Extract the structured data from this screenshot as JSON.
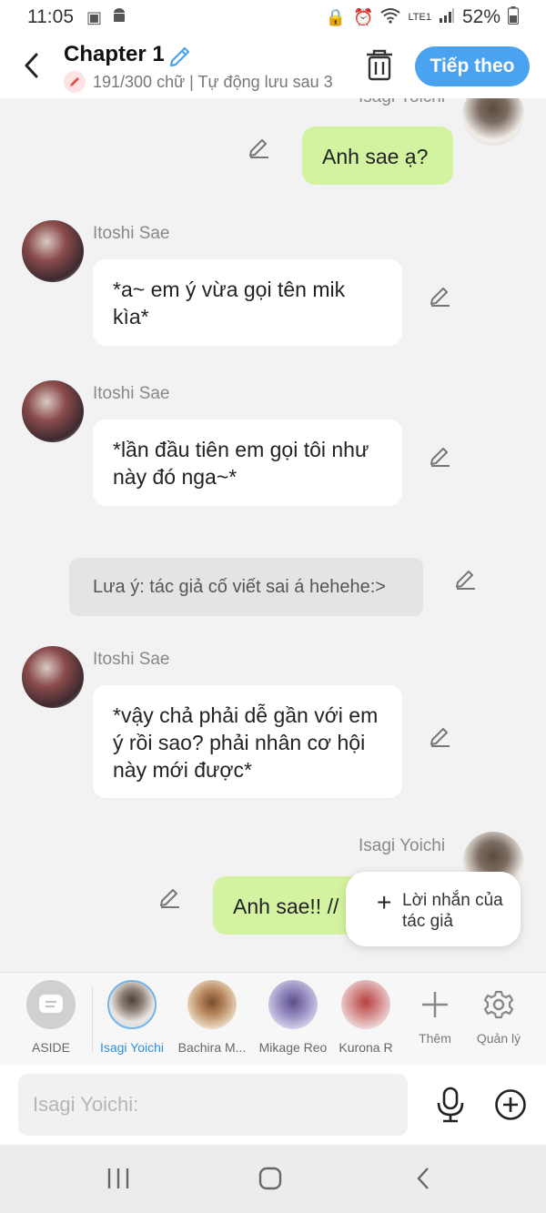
{
  "status_bar": {
    "time": "11:05",
    "lte": "LTE1",
    "battery": "52%"
  },
  "header": {
    "title": "Chapter 1",
    "word_count": "191/300 chữ",
    "autosave": "| Tự động lưu sau 3",
    "next_label": "Tiếp theo"
  },
  "messages": {
    "m0": {
      "sender": "Isagi Yoichi",
      "text": "Anh sae ạ?"
    },
    "m1": {
      "sender": "Itoshi Sae",
      "text": "*a~ em ý vừa gọi tên mik kìa*"
    },
    "m2": {
      "sender": "Itoshi Sae",
      "text": "*lần đầu tiên em gọi tôi như này đó nga~*"
    },
    "m3": {
      "text": "Lưa ý: tác giả cố viết sai á hehehe:>"
    },
    "m4": {
      "sender": "Itoshi Sae",
      "text": "*vậy chả phải dễ gần với em ý rồi sao? phải nhân cơ hội này mới được*"
    },
    "m5": {
      "sender": "Isagi Yoichi",
      "text": "Anh sae!! //"
    }
  },
  "popup": {
    "label": "Lời nhắn của tác giả"
  },
  "characters": [
    {
      "name": "ASIDE"
    },
    {
      "name": "Isagi Yoichi"
    },
    {
      "name": "Bachira M..."
    },
    {
      "name": "Mikage Reo"
    },
    {
      "name": "Kurona R"
    }
  ],
  "tools": {
    "add_label": "Thêm",
    "manage_label": "Quản lý"
  },
  "input": {
    "placeholder": "Isagi Yoichi:"
  },
  "colors": {
    "accent": "#4aa3f0",
    "right_bubble": "#d4f3a0",
    "left_bubble": "#ffffff",
    "background": "#f2f2f2"
  }
}
